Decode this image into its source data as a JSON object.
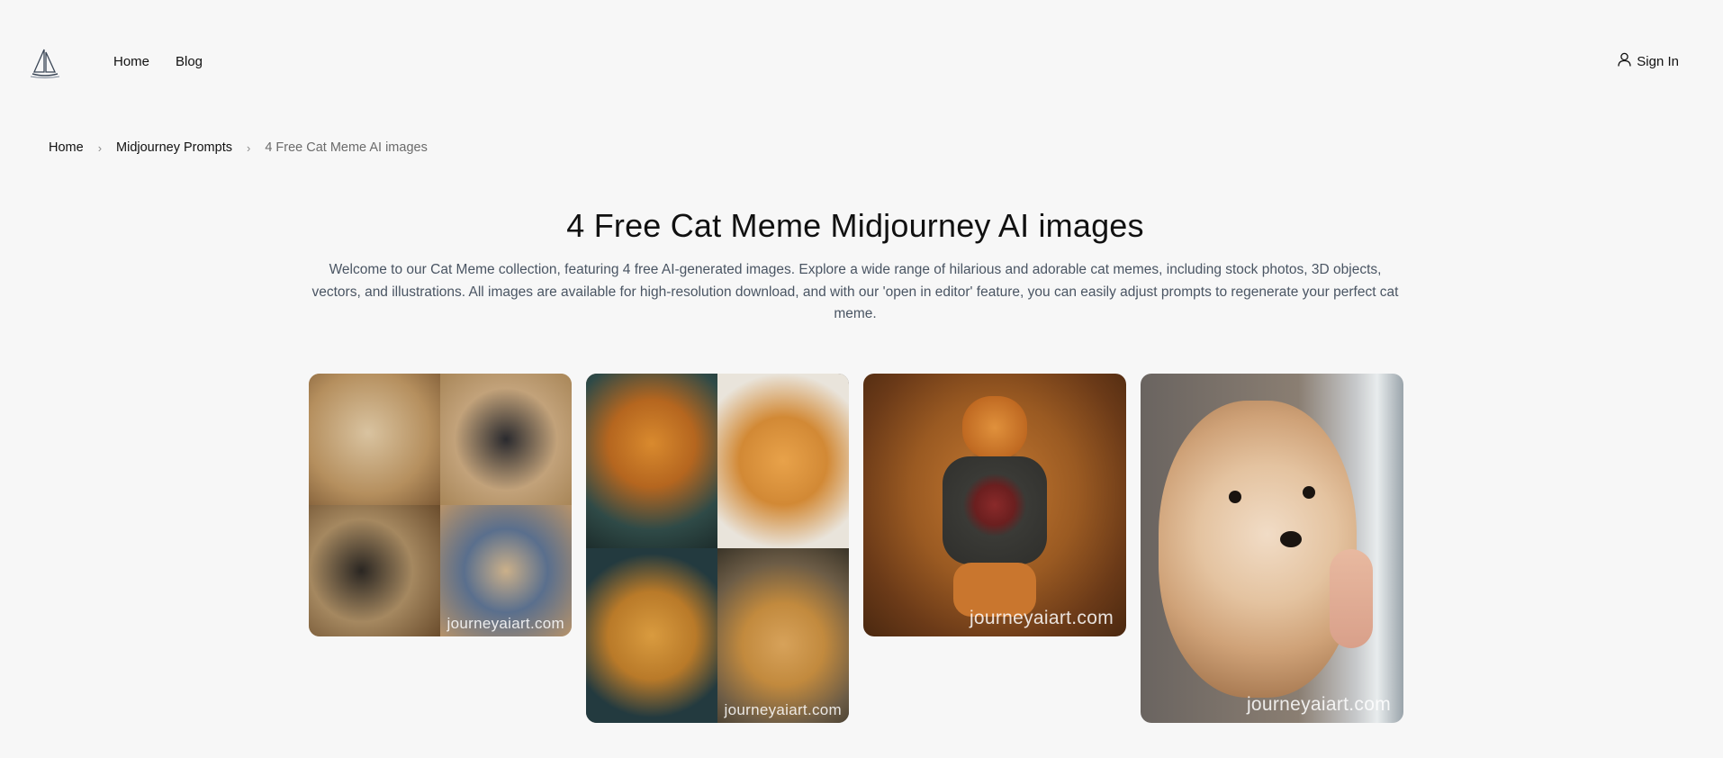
{
  "nav": {
    "home_label": "Home",
    "blog_label": "Blog",
    "signin_label": "Sign In"
  },
  "breadcrumb": {
    "home": "Home",
    "category": "Midjourney Prompts",
    "current": "4 Free Cat Meme AI images"
  },
  "page": {
    "title": "4 Free Cat Meme Midjourney AI images",
    "description": "Welcome to our Cat Meme collection, featuring 4 free AI-generated images. Explore a wide range of hilarious and adorable cat memes, including stock photos, 3D objects, vectors, and illustrations. All images are available for high-resolution download, and with our 'open in editor' feature, you can easily adjust prompts to regenerate your perfect cat meme."
  },
  "gallery": {
    "images": [
      {
        "watermark": "journeyaiart.com"
      },
      {
        "watermark": "journeyaiart.com"
      },
      {
        "watermark": "journeyaiart.com"
      },
      {
        "watermark": "journeyaiart.com"
      }
    ]
  },
  "colors": {
    "background": "#f7f7f7",
    "text": "#111111",
    "muted": "#6b6b6b",
    "description": "#4a5563"
  },
  "icons": {
    "logo": "sailboat-logo-icon",
    "signin": "user-icon",
    "breadcrumb_separator": "chevron-right-icon"
  }
}
